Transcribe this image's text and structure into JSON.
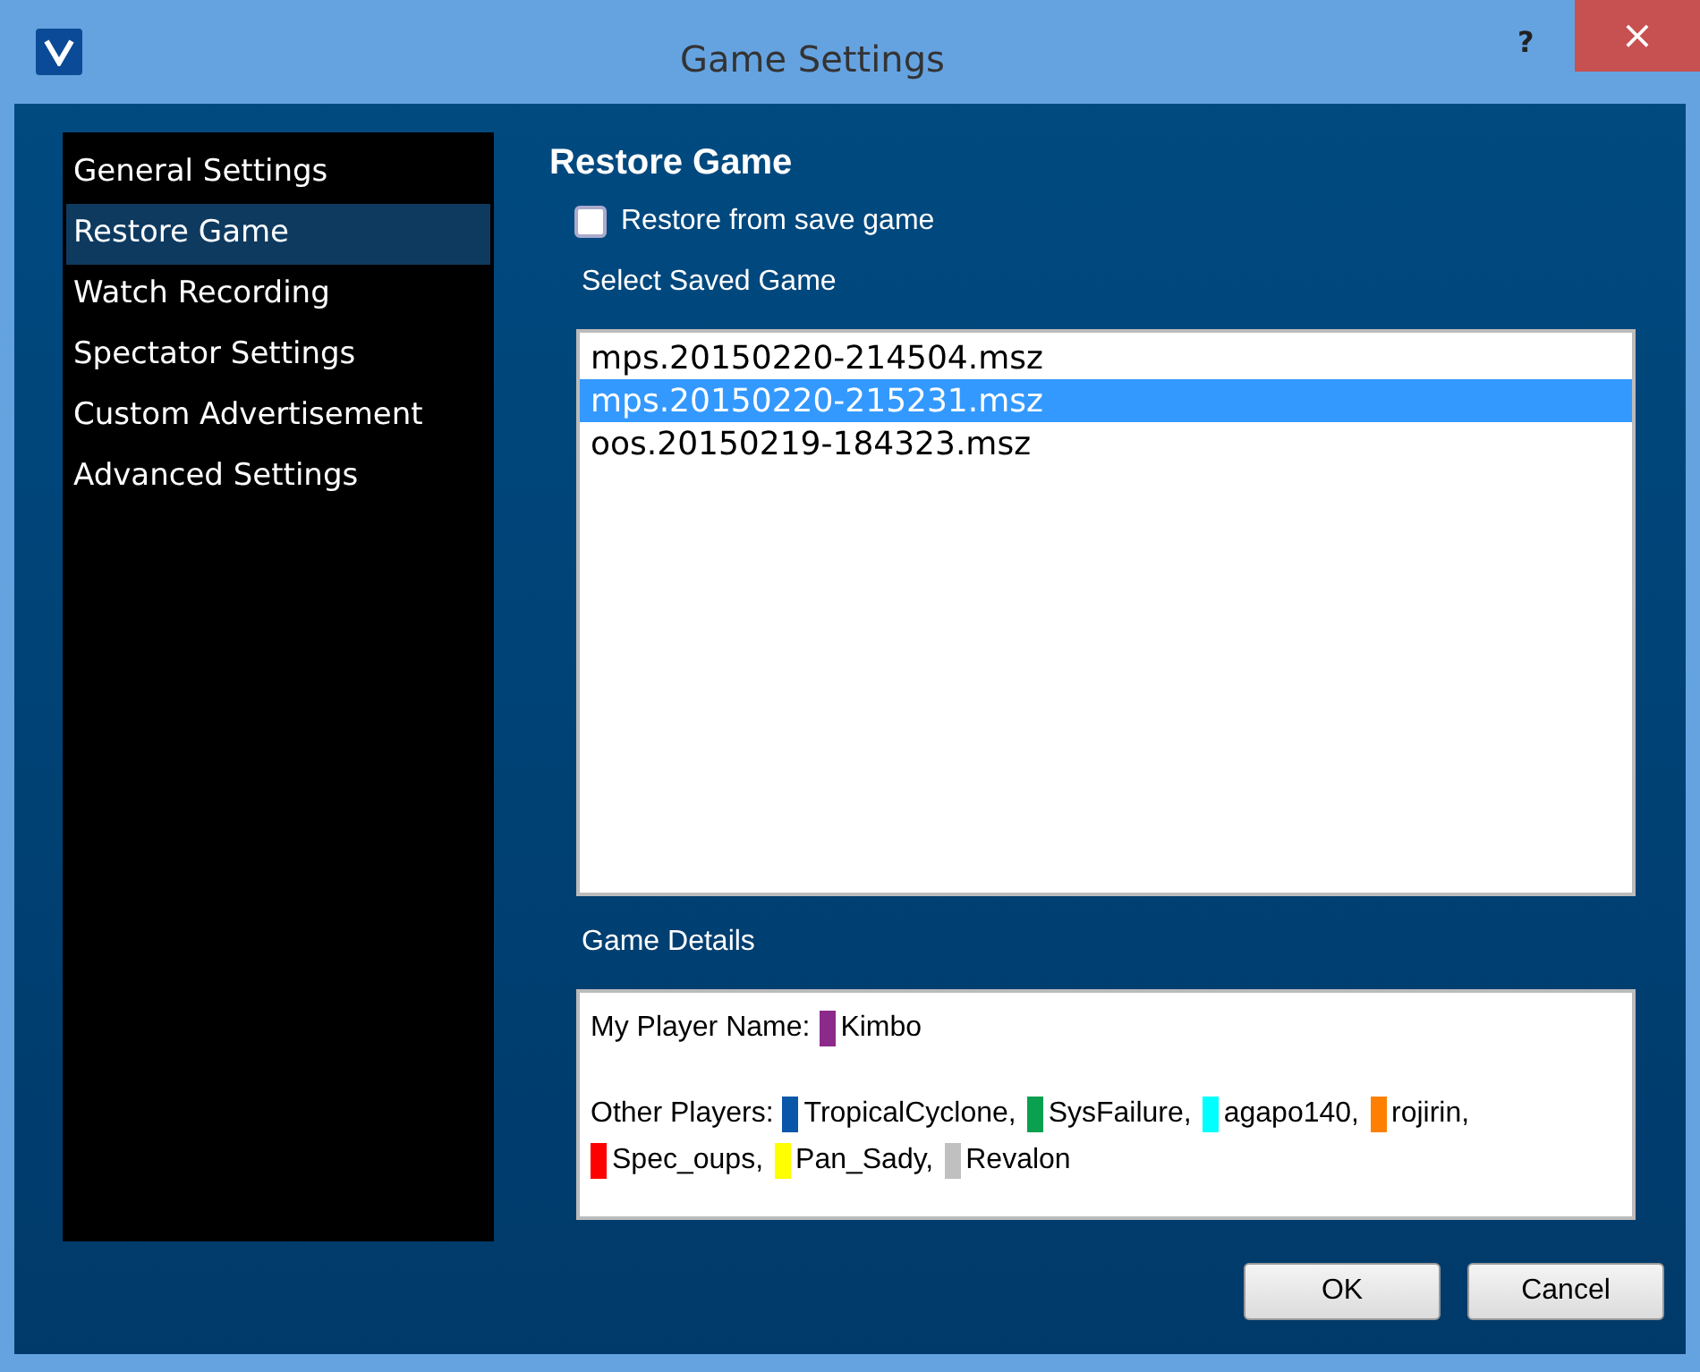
{
  "window": {
    "title": "Game Settings",
    "help": "?",
    "close": "×"
  },
  "sidebar": {
    "items": [
      {
        "label": "General Settings",
        "selected": false
      },
      {
        "label": "Restore Game",
        "selected": true
      },
      {
        "label": "Watch Recording",
        "selected": false
      },
      {
        "label": "Spectator Settings",
        "selected": false
      },
      {
        "label": "Custom Advertisement",
        "selected": false
      },
      {
        "label": "Advanced Settings",
        "selected": false
      }
    ]
  },
  "panel": {
    "heading": "Restore Game",
    "restore_checkbox": {
      "label": "Restore from save game",
      "checked": false
    },
    "saved_games_label": "Select Saved Game",
    "saved_games": [
      {
        "name": "mps.20150220-214504.msz",
        "selected": false
      },
      {
        "name": "mps.20150220-215231.msz",
        "selected": true
      },
      {
        "name": "oos.20150219-184323.msz",
        "selected": false
      }
    ],
    "details_label": "Game Details",
    "details": {
      "my_player_label": "My Player Name:",
      "my_player": {
        "name": "Kimbo",
        "color": "#8b2a8b"
      },
      "other_players_label": "Other Players:",
      "other_players": [
        {
          "name": "TropicalCyclone,",
          "color": "#0a56a8"
        },
        {
          "name": "SysFailure,",
          "color": "#0aa050"
        },
        {
          "name": "agapo140,",
          "color": "#00ffff"
        },
        {
          "name": "rojirin,",
          "color": "#ff8000"
        },
        {
          "name": "Spec_oups,",
          "color": "#ff0000"
        },
        {
          "name": "Pan_Sady,",
          "color": "#ffff00"
        },
        {
          "name": "Revalon",
          "color": "#c0c0c0"
        }
      ]
    }
  },
  "buttons": [
    "OK",
    "Cancel"
  ]
}
